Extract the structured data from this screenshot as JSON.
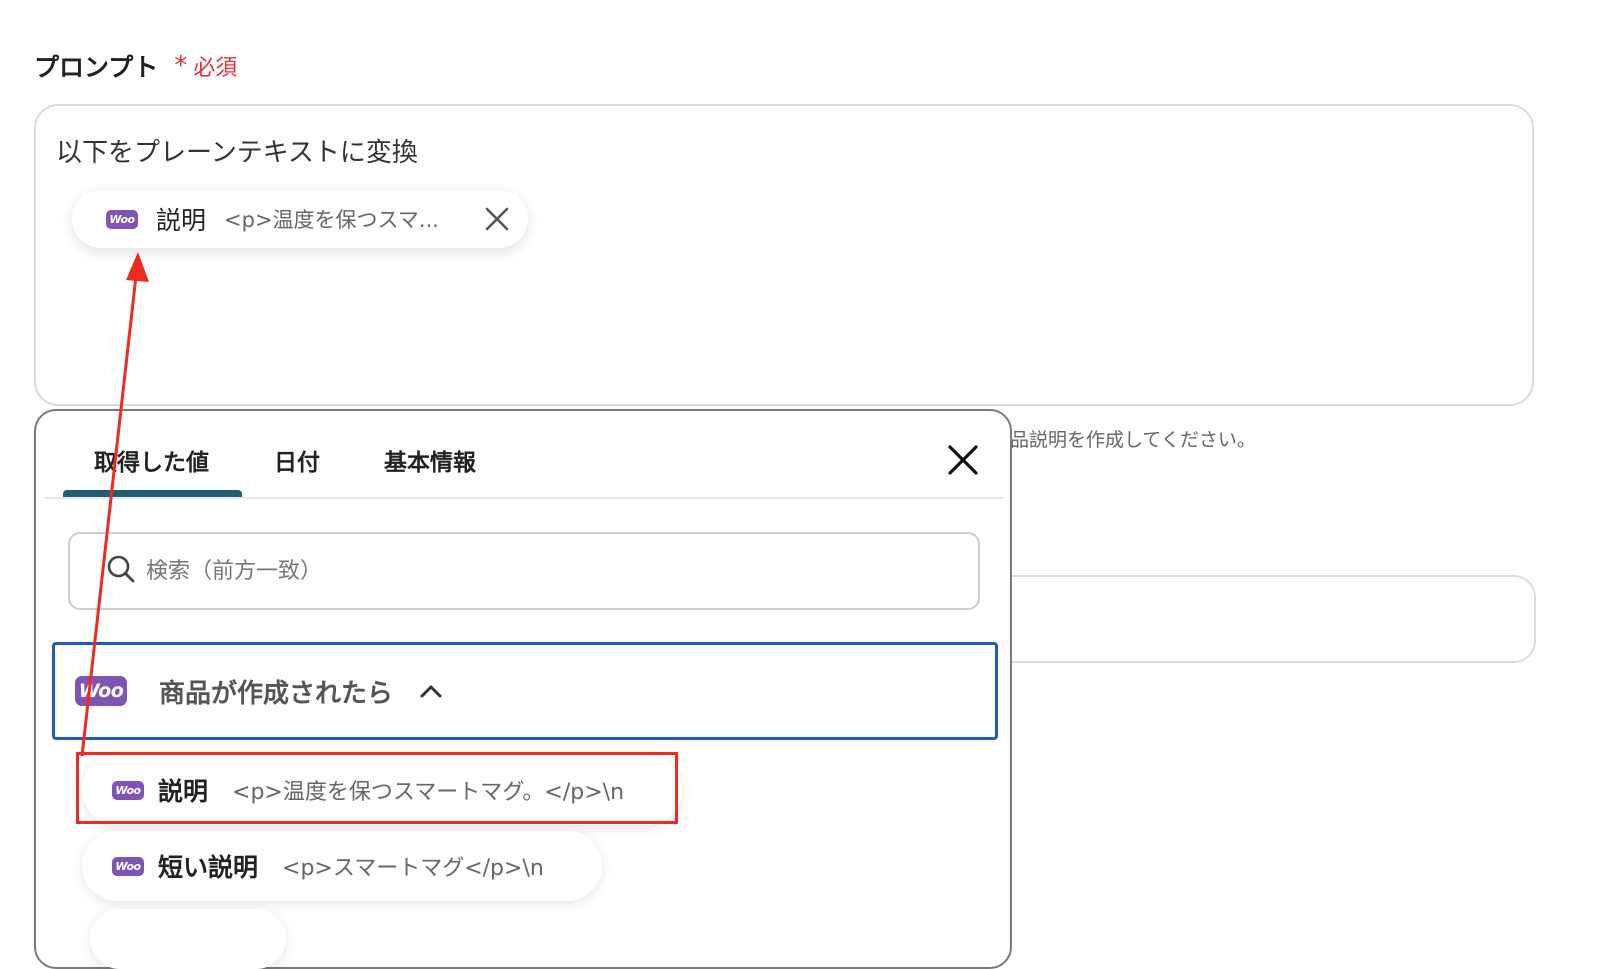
{
  "field": {
    "label": "プロンプト",
    "required_mark": "*",
    "required_text": "必須"
  },
  "prompt": {
    "text": "以下をプレーンテキストに変換",
    "chip": {
      "name": "説明",
      "value": "<p>温度を保つスマ..."
    }
  },
  "hint_text": "品説明を作成してください。",
  "panel": {
    "tabs": [
      "取得した値",
      "日付",
      "基本情報"
    ],
    "active_tab": 0,
    "search_placeholder": "検索（前方一致）",
    "group": {
      "title": "商品が作成されたら",
      "icon": "woo"
    },
    "items": [
      {
        "name": "説明",
        "value": "<p>温度を保つスマートマグ。</p>\\n",
        "highlighted": true
      },
      {
        "name": "短い説明",
        "value": "<p>スマートマグ</p>\\n",
        "highlighted": false
      }
    ]
  },
  "icons": {
    "brand": "woo",
    "search": "search-icon",
    "close": "close-icon",
    "chevron": "chevron-up-icon"
  },
  "colors": {
    "required": "#e5323b",
    "woo": "#7f54b3",
    "active_tab": "#1e5f74",
    "group_border": "#1f5bb8",
    "annotation": "#ef2a1f"
  }
}
